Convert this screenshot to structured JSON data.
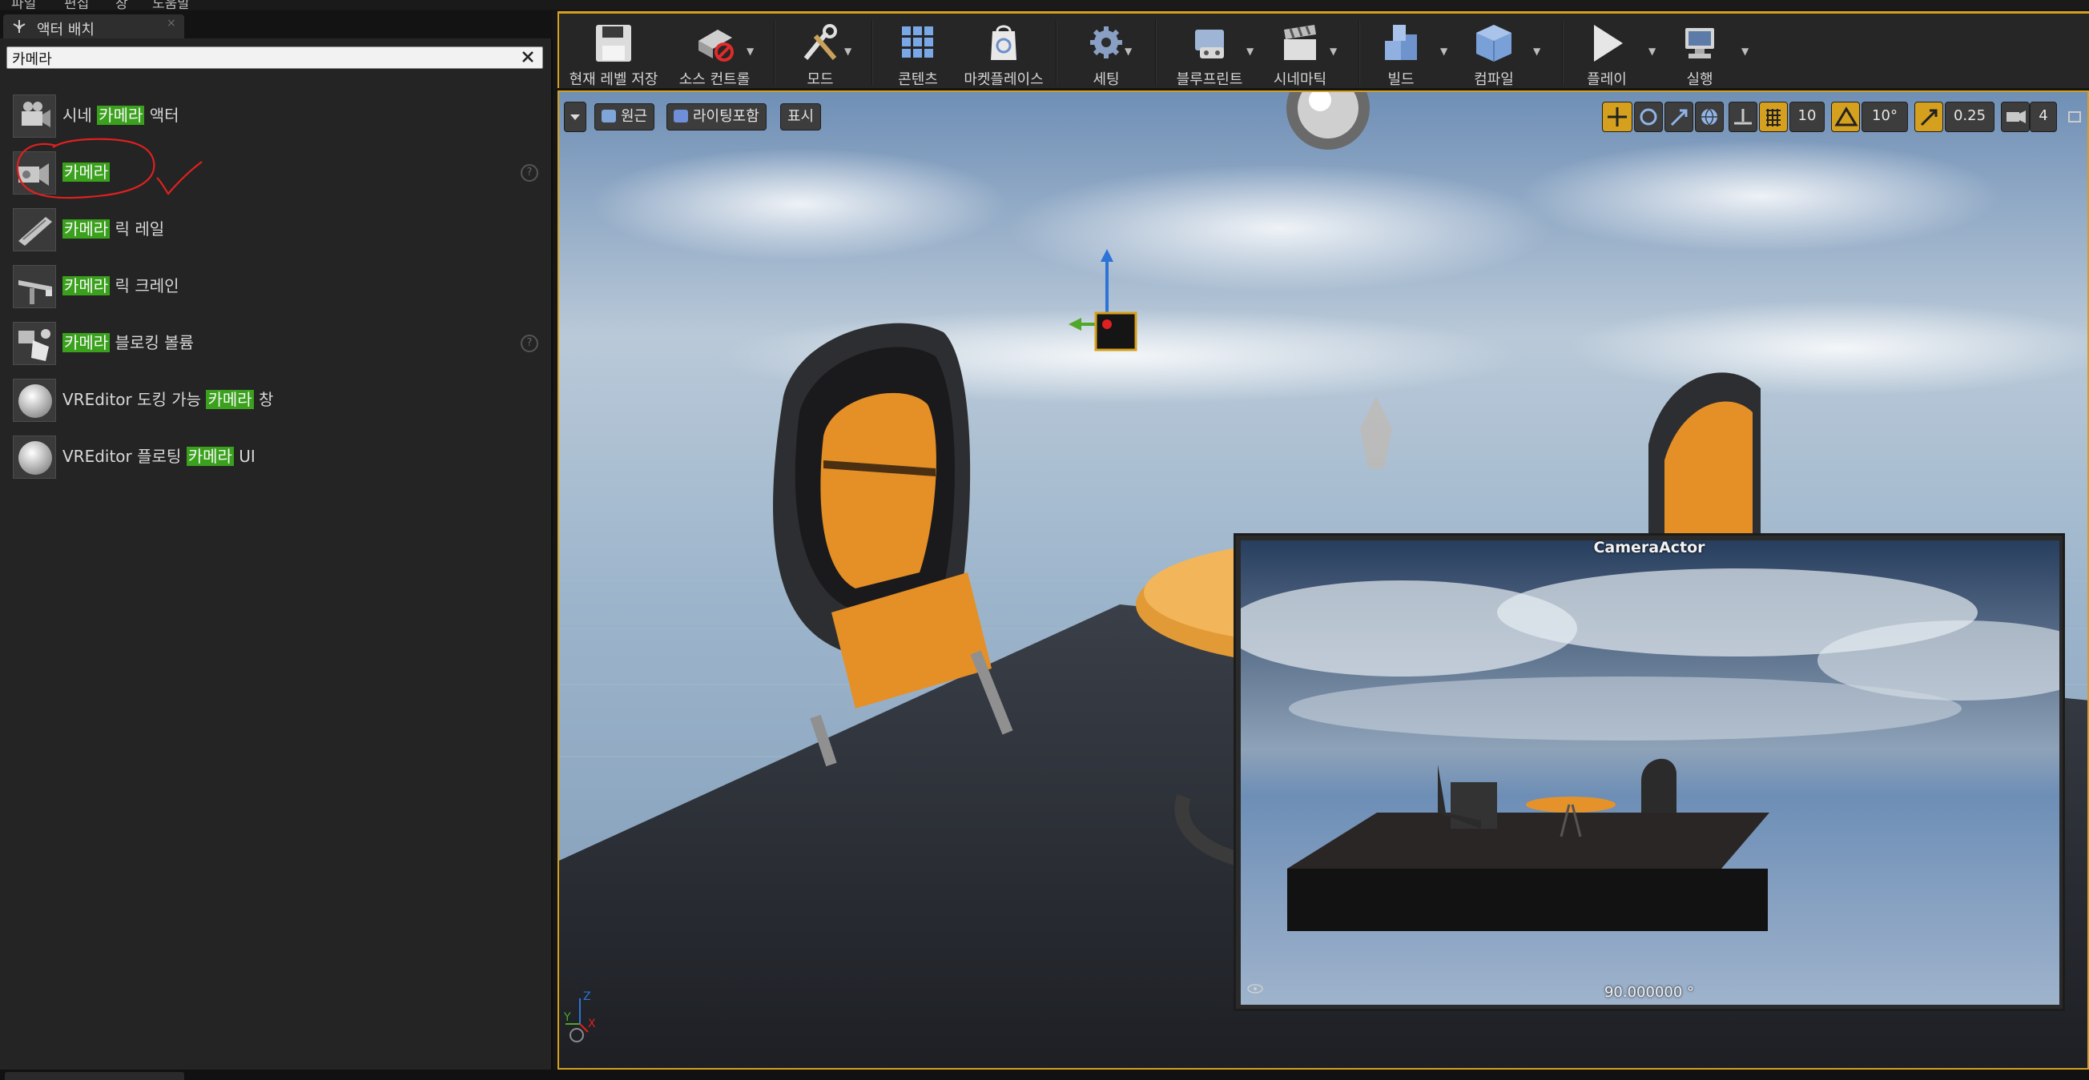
{
  "menu": [
    "파일",
    "편집",
    "창",
    "도움말"
  ],
  "panel": {
    "tab_label": "액터 배치",
    "tab_close": "×",
    "search_value": "카메라",
    "items": [
      {
        "pre": "시네 ",
        "hl": "카메라",
        "post": " 액터",
        "help": false
      },
      {
        "pre": "",
        "hl": "카메라",
        "post": "",
        "help": true
      },
      {
        "pre": "",
        "hl": "카메라",
        "post": " 릭 레일",
        "help": false
      },
      {
        "pre": "",
        "hl": "카메라",
        "post": " 릭 크레인",
        "help": false
      },
      {
        "pre": "",
        "hl": "카메라",
        "post": " 블로킹 볼륨",
        "help": true
      },
      {
        "pre": "VREditor 도킹 가능 ",
        "hl": "카메라",
        "post": " 창",
        "help": false
      },
      {
        "pre": "VREditor 플로팅 ",
        "hl": "카메라",
        "post": " UI",
        "help": false
      }
    ],
    "help_glyph": "?"
  },
  "toolbar": {
    "save": "현재 레벨 저장",
    "source_control": "소스 컨트롤",
    "modes": "모드",
    "content": "콘텐츠",
    "marketplace": "마켓플레이스",
    "settings": "세팅",
    "blueprints": "블루프린트",
    "cinematics": "시네마틱",
    "build": "빌드",
    "compile": "컴파일",
    "play": "플레이",
    "launch": "실행",
    "dropdown_glyph": "▼"
  },
  "viewport": {
    "view_mode": "원근",
    "lighting": "라이팅포함",
    "show": "표시",
    "grid_snap": "10",
    "rotation_snap": "10°",
    "scale_snap": "0.25",
    "camera_speed": "4",
    "preview_title": "CameraActor",
    "preview_fov": "90.000000 °",
    "axis_z": "Z",
    "axis_y": "Y",
    "axis_x": "X"
  },
  "colors": {
    "accent": "#d5a01d",
    "highlight": "#3aa11c",
    "annotation": "#e02020"
  }
}
